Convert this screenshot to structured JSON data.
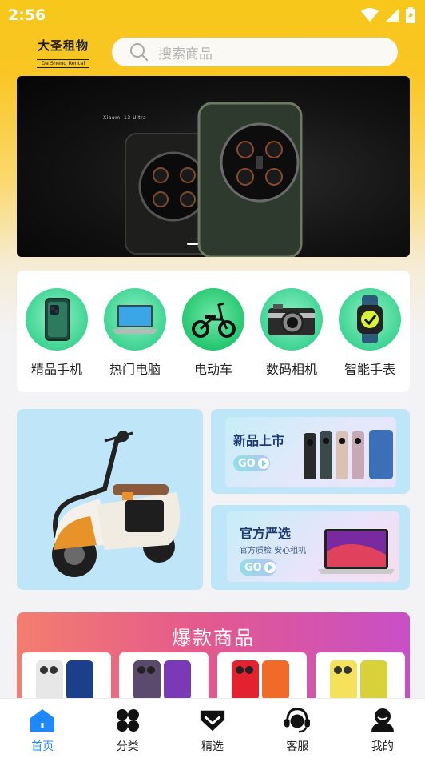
{
  "status": {
    "time": "2:56"
  },
  "header": {
    "logo_cn": "大圣租物",
    "logo_en": "Da Sheng Rental",
    "search_placeholder": "搜索商品"
  },
  "banner": {
    "product_tag": "Xiaomi 13 Ultra",
    "page_indicator": "1"
  },
  "categories": [
    {
      "label": "精品手机",
      "icon": "phone-icon"
    },
    {
      "label": "热门电脑",
      "icon": "laptop-icon"
    },
    {
      "label": "电动车",
      "icon": "ebike-icon"
    },
    {
      "label": "数码相机",
      "icon": "camera-icon"
    },
    {
      "label": "智能手表",
      "icon": "watch-icon"
    }
  ],
  "promos": {
    "new": {
      "title": "新品上市",
      "go": "GO"
    },
    "official": {
      "title": "官方严选",
      "subtitle": "官方质检 安心租机",
      "go": "GO"
    }
  },
  "hot": {
    "title": "爆款商品"
  },
  "tabbar": [
    {
      "label": "首页",
      "icon": "home-icon",
      "active": true
    },
    {
      "label": "分类",
      "icon": "category-icon",
      "active": false
    },
    {
      "label": "精选",
      "icon": "featured-icon",
      "active": false
    },
    {
      "label": "客服",
      "icon": "customer-service-icon",
      "active": false
    },
    {
      "label": "我的",
      "icon": "profile-icon",
      "active": false
    }
  ],
  "colors": {
    "brand_yellow": "#f9c623",
    "tab_active": "#1e88ff",
    "category_green": "#3fd493",
    "promo_blue": "#bfe6f8"
  }
}
